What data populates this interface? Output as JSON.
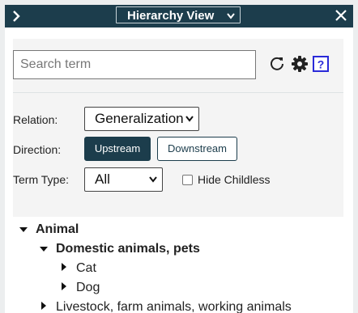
{
  "titlebar": {
    "view_selected": "Hierarchy View"
  },
  "search": {
    "placeholder": "Search term"
  },
  "relation": {
    "label": "Relation:",
    "selected": "Generalization"
  },
  "direction": {
    "label": "Direction:",
    "upstream_label": "Upstream",
    "downstream_label": "Downstream"
  },
  "term_type": {
    "label": "Term Type:",
    "selected": "All"
  },
  "hide_childless": {
    "label": "Hide Childless",
    "checked": false
  },
  "tree": {
    "nodes": [
      {
        "label": "Animal",
        "expanded": true
      },
      {
        "label": "Domestic animals, pets",
        "expanded": true
      },
      {
        "label": "Cat",
        "expanded": false
      },
      {
        "label": "Dog",
        "expanded": false
      },
      {
        "label": "Livestock, farm animals, working animals",
        "expanded": false
      }
    ]
  },
  "colors": {
    "primary": "#1c3d4c",
    "help_icon": "#2a2ad8",
    "panel_bg": "#f4f4f4"
  },
  "icons": {
    "collapse": "chevron-right-icon",
    "close": "close-icon",
    "refresh": "refresh-icon",
    "settings": "gear-icon",
    "help": "help-icon"
  }
}
